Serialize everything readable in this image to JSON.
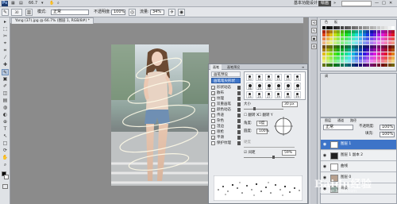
{
  "titlebar": {
    "app_icon": "Ps",
    "zoom": "66.7",
    "workspace_basic": "基本功能",
    "workspace_design": "设计",
    "workspace_active": "绘画",
    "window_controls": [
      "—",
      "□",
      "✕"
    ]
  },
  "options_bar": {
    "brush_size": "30",
    "mode_label": "模式:",
    "mode_value": "正常",
    "opacity_label": "不透明度:",
    "opacity_value": "100%",
    "flow_label": "流量:",
    "flow_value": "34%"
  },
  "document": {
    "tab_label": "Yang (37).jpg @ 66.7% (图层 1, RGB/8#) *"
  },
  "toolbar": {
    "tools": [
      "▸",
      "⬚",
      "✂",
      "⌖",
      "✎",
      "▣",
      "✐",
      "⊕",
      "▤",
      "◐",
      "T",
      "↖",
      "□",
      "✋",
      "⌕"
    ]
  },
  "brush_panel": {
    "tabs": [
      "画笔",
      "画笔预设"
    ],
    "preset_button": "画笔预设",
    "tip_button": "画笔笔尖形状",
    "options": [
      "形状动态",
      "散布",
      "纹理",
      "双重画笔",
      "颜色动态",
      "传递",
      "杂色",
      "湿边",
      "喷枪",
      "平滑",
      "保护纹理"
    ],
    "checked": [
      true,
      true,
      false,
      false,
      true,
      false,
      false,
      false,
      false,
      true,
      false
    ],
    "presets": [
      "30",
      "30",
      "30",
      "25",
      "25",
      "25",
      "36",
      "25",
      "36",
      "36",
      "32",
      "25",
      "14",
      "24",
      "27",
      "39",
      "46",
      "59",
      "11",
      "17",
      "23",
      "36",
      "44",
      "60"
    ],
    "size_label": "大小",
    "size_value": "30 px",
    "flipx_label": "翻转 X",
    "flipy_label": "翻转 Y",
    "angle_label": "角度:",
    "angle_value": "0度",
    "roundness_label": "圆度:",
    "roundness_value": "100%",
    "hardness_label": "硬度",
    "spacing_label": "间距",
    "spacing_value": "59%"
  },
  "layers_panel": {
    "tabs": [
      "图层",
      "通道",
      "路径"
    ],
    "blend_mode": "正常",
    "opacity_label": "不透明度:",
    "opacity_value": "100%",
    "fill_label": "填充:",
    "fill_value": "100%",
    "layers": [
      {
        "name": "图层 1",
        "selected": true
      },
      {
        "name": "图层 1 副本 2",
        "selected": false
      },
      {
        "name": "曲线",
        "selected": false
      },
      {
        "name": "图层 0",
        "selected": false
      },
      {
        "name": "背景",
        "selected": false
      }
    ]
  },
  "watermark": {
    "text": "Baidu经验",
    "sub": "jingyan.baidu.com"
  },
  "colors": {
    "selection": "#3d74c8",
    "panel_bg": "#e9ebee",
    "canvas_bg": "#8b8b8b"
  }
}
